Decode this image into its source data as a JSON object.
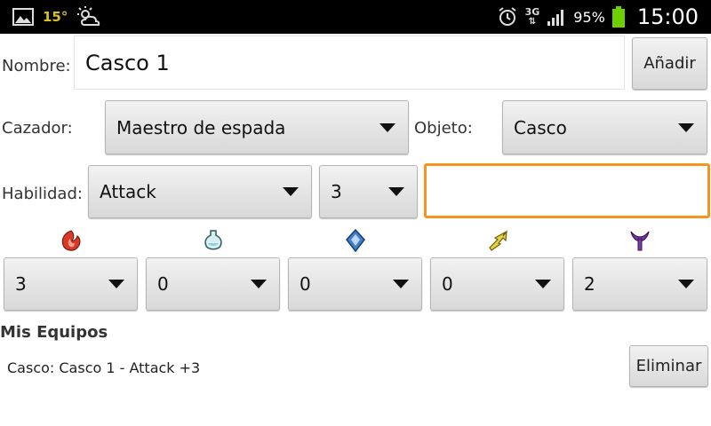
{
  "status_bar": {
    "temperature": "15°",
    "network": "3G",
    "battery_percent": "95%",
    "time": "15:00",
    "icons": [
      "gallery-icon",
      "weather-icon",
      "alarm-icon",
      "signal-icon",
      "battery-icon"
    ]
  },
  "form": {
    "nombre_label": "Nombre:",
    "nombre_value": "Casco 1",
    "add_button": "Añadir",
    "cazador_label": "Cazador:",
    "cazador_value": "Maestro de espada",
    "objeto_label": "Objeto:",
    "objeto_value": "Casco",
    "habilidad_label": "Habilidad:",
    "habilidad_value": "Attack",
    "habilidad_level": "3",
    "habilidad_text": ""
  },
  "stats": [
    {
      "icon": "fire-element-icon",
      "color": "#d83a2a",
      "value": "3"
    },
    {
      "icon": "water-element-icon",
      "color": "#8fd2d8",
      "value": "0"
    },
    {
      "icon": "ice-element-icon",
      "color": "#3f7ec9",
      "value": "0"
    },
    {
      "icon": "thunder-element-icon",
      "color": "#d9c52a",
      "value": "0"
    },
    {
      "icon": "dragon-element-icon",
      "color": "#7b3aa8",
      "value": "2"
    }
  ],
  "equipos": {
    "title": "Mis Equipos",
    "items": [
      {
        "text": "Casco: Casco 1 - Attack +3",
        "delete_label": "Eliminar"
      }
    ]
  }
}
